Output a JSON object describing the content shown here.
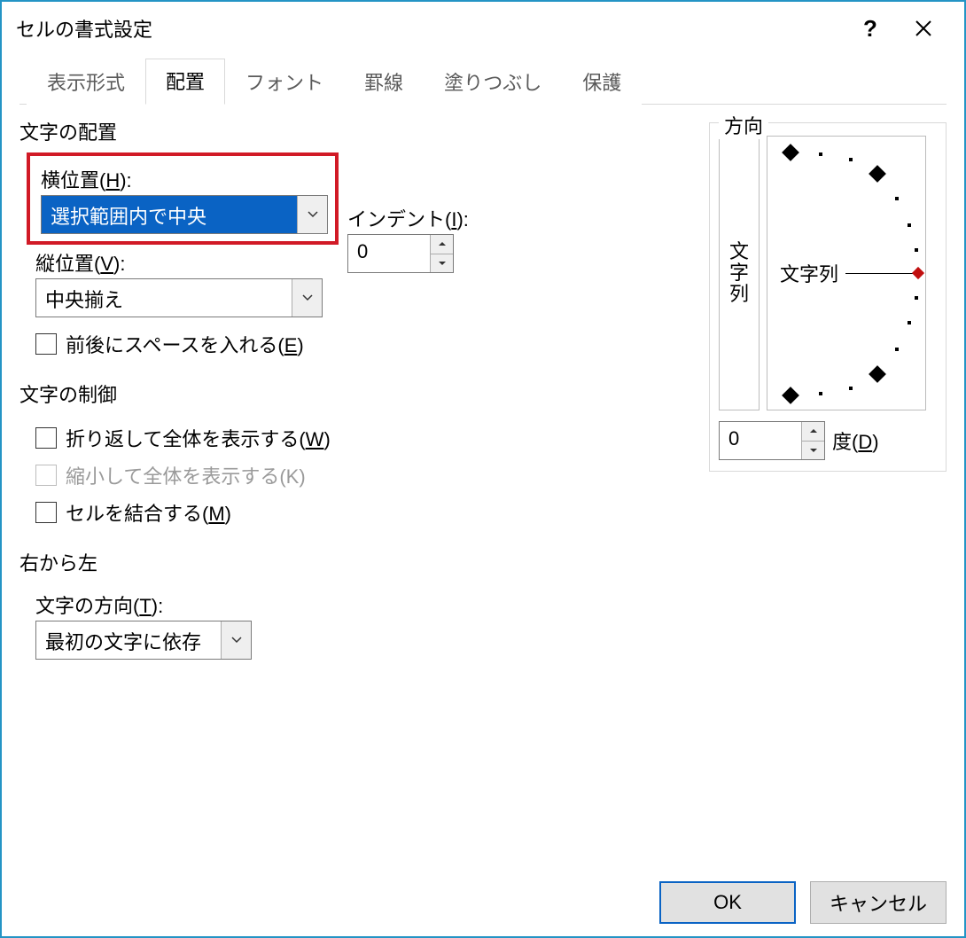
{
  "window": {
    "title": "セルの書式設定"
  },
  "tabs": {
    "0": {
      "label": "表示形式"
    },
    "1": {
      "label": "配置"
    },
    "2": {
      "label": "フォント"
    },
    "3": {
      "label": "罫線"
    },
    "4": {
      "label": "塗りつぶし"
    },
    "5": {
      "label": "保護"
    },
    "active_index": 1
  },
  "alignment": {
    "section_title": "文字の配置",
    "horizontal": {
      "label_pre": "横位置(",
      "hotkey": "H",
      "label_post": "):",
      "value": "選択範囲内で中央"
    },
    "indent": {
      "label_pre": "インデント(",
      "hotkey": "I",
      "label_post": "):",
      "value": "0"
    },
    "vertical": {
      "label_pre": "縦位置(",
      "hotkey": "V",
      "label_post": "):",
      "value": "中央揃え"
    },
    "justify_distributed": {
      "label_pre": "前後にスペースを入れる(",
      "hotkey": "E",
      "label_post": ")",
      "checked": false
    }
  },
  "text_control": {
    "section_title": "文字の制御",
    "wrap": {
      "label_pre": "折り返して全体を表示する(",
      "hotkey": "W",
      "label_post": ")",
      "checked": false
    },
    "shrink": {
      "label": "縮小して全体を表示する(K)",
      "checked": false,
      "enabled": false
    },
    "merge": {
      "label_pre": "セルを結合する(",
      "hotkey": "M",
      "label_post": ")",
      "checked": false
    }
  },
  "rtl": {
    "section_title": "右から左",
    "direction": {
      "label_pre": "文字の方向(",
      "hotkey": "T",
      "label_post": "):",
      "value": "最初の文字に依存"
    }
  },
  "orientation": {
    "section_title": "方向",
    "vertical_text": "文字列",
    "dial_label": "文字列",
    "degrees": "0",
    "degrees_label_pre": "度(",
    "degrees_hotkey": "D",
    "degrees_label_post": ")"
  },
  "buttons": {
    "ok": "OK",
    "cancel": "キャンセル"
  }
}
